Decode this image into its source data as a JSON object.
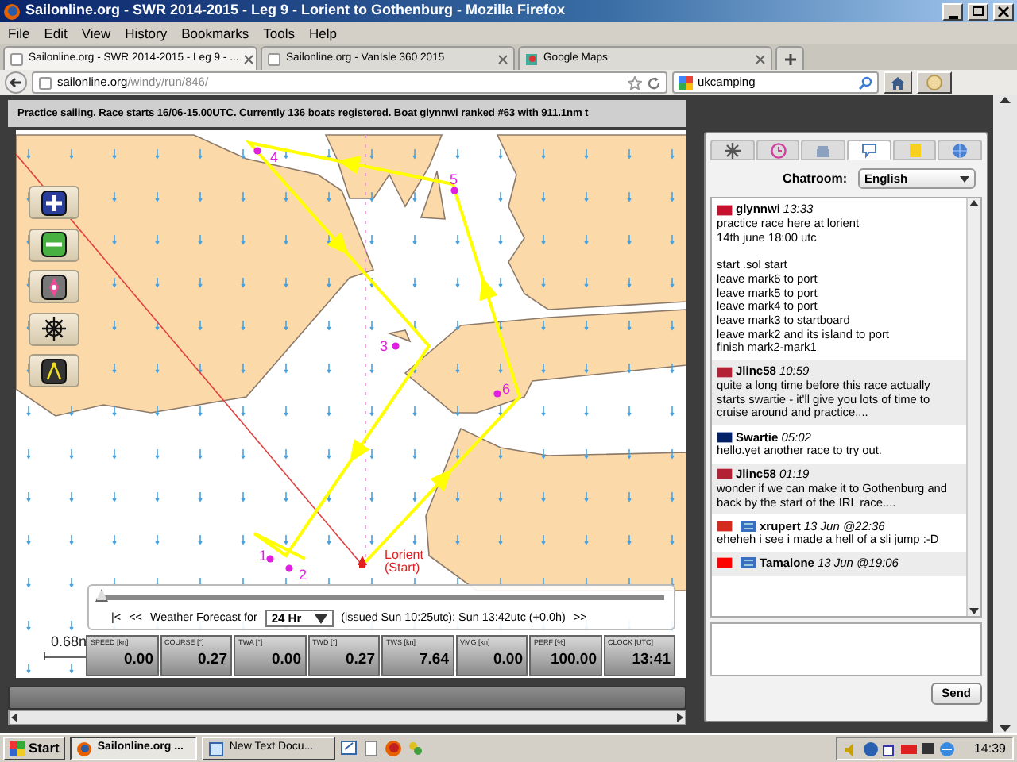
{
  "window": {
    "title": "Sailonline.org - SWR 2014-2015 - Leg 9 - Lorient to Gothenburg - Mozilla Firefox"
  },
  "menu": [
    "File",
    "Edit",
    "View",
    "History",
    "Bookmarks",
    "Tools",
    "Help"
  ],
  "tabs": [
    {
      "label": "Sailonline.org - SWR 2014-2015 - Leg 9 - ...",
      "selected": true
    },
    {
      "label": "Sailonline.org - VanIsle 360 2015",
      "selected": false
    },
    {
      "label": "Google Maps",
      "selected": false
    }
  ],
  "address_bar": {
    "host": "sailonline.org",
    "path": "/windy/run/846/"
  },
  "search": {
    "value": "ukcamping"
  },
  "race_info": "Practice sailing. Race starts 16/06-15.00UTC. Currently 136 boats registered. Boat glynnwi ranked #63 with 911.1nm t",
  "map": {
    "marks": [
      {
        "label": "4"
      },
      {
        "label": "5"
      },
      {
        "label": "3"
      },
      {
        "label": "6"
      },
      {
        "label": "1"
      },
      {
        "label": "2"
      }
    ],
    "start": {
      "name": "Lorient",
      "note": "(Start)"
    },
    "scale": "0.68n"
  },
  "forecast": {
    "first": "|<",
    "prev": "<<",
    "label": "Weather Forecast for",
    "period": "24 Hr",
    "issued": "(issued Sun 10:25utc): Sun 13:42utc  (+0.0h)",
    "next": ">>",
    "level": 0
  },
  "instruments": [
    {
      "label": "SPEED [kn]",
      "value": "0.00"
    },
    {
      "label": "COURSE [°]",
      "value": "0.27"
    },
    {
      "label": "TWA [°]",
      "value": "0.00"
    },
    {
      "label": "TWD [°]",
      "value": "0.27"
    },
    {
      "label": "TWS [kn]",
      "value": "7.64"
    },
    {
      "label": "VMG [kn]",
      "value": "0.00"
    },
    {
      "label": "PERF [%]",
      "value": "100.00"
    },
    {
      "label": "CLOCK [UTC]",
      "value": "13:41"
    }
  ],
  "chat": {
    "tabs": [
      {
        "selected": false
      },
      {
        "selected": false
      },
      {
        "selected": false
      },
      {
        "selected": true
      },
      {
        "selected": false
      },
      {
        "selected": false
      }
    ],
    "room_label": "Chatroom:",
    "room": "English",
    "messages": [
      {
        "user": "glynnwi",
        "time": "13:33",
        "color": "#c8102e",
        "team_badge": false,
        "text": "practice race here at lorient\n14th june 18:00 utc\n\nstart .sol start\nleave mark6 to port\nleave mark5 to port\nleave mark4 to port\nleave mark3 to startboard\nleave mark2 and its island to port\nfinish mark2-mark1"
      },
      {
        "user": "Jlinc58",
        "time": "10:59",
        "color": "#b22234",
        "team_badge": false,
        "text": "quite a long time before this race actually starts swartie - it'll give you lots of time to cruise around and practice...."
      },
      {
        "user": "Swartie",
        "time": "05:02",
        "color": "#012169",
        "team_badge": false,
        "text": "hello.yet another race to try out."
      },
      {
        "user": "Jlinc58",
        "time": "01:19",
        "color": "#b22234",
        "team_badge": false,
        "text": "wonder if we can make it to Gothenburg and back by the start of the IRL race...."
      },
      {
        "user": "xrupert",
        "time": "13 Jun @22:36",
        "color": "#d52b1e",
        "team_badge": true,
        "text": "eheheh i see i made a hell of a sli jump :-D"
      },
      {
        "user": "Tamalone",
        "time": "13 Jun @19:06",
        "color": "#ff0000",
        "team_badge": true
      }
    ],
    "send": "Send"
  },
  "taskbar": {
    "start": "Start",
    "tasks": [
      {
        "label": "Sailonline.org ...",
        "selected": true
      },
      {
        "label": "New Text Docu...",
        "selected": false
      }
    ],
    "clock": "14:39"
  }
}
